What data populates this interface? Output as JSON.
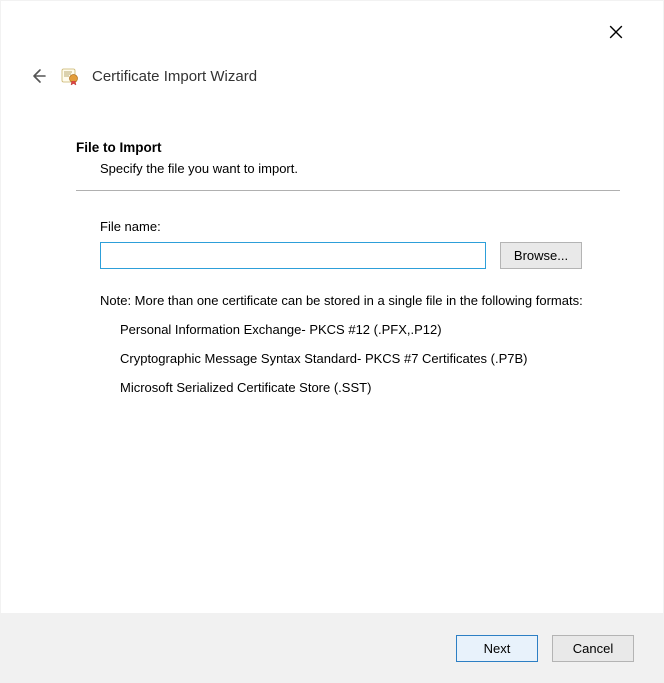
{
  "header": {
    "wizard_title": "Certificate Import Wizard"
  },
  "step": {
    "title": "File to Import",
    "subtitle": "Specify the file you want to import."
  },
  "field": {
    "label": "File name:",
    "value": "",
    "browse_label": "Browse..."
  },
  "note": {
    "prefix": "Note:  More than one certificate can be stored in a single file in the following formats:",
    "formats": [
      "Personal Information Exchange- PKCS #12 (.PFX,.P12)",
      "Cryptographic Message Syntax Standard- PKCS #7 Certificates (.P7B)",
      "Microsoft Serialized Certificate Store (.SST)"
    ]
  },
  "footer": {
    "next_label": "Next",
    "cancel_label": "Cancel"
  }
}
